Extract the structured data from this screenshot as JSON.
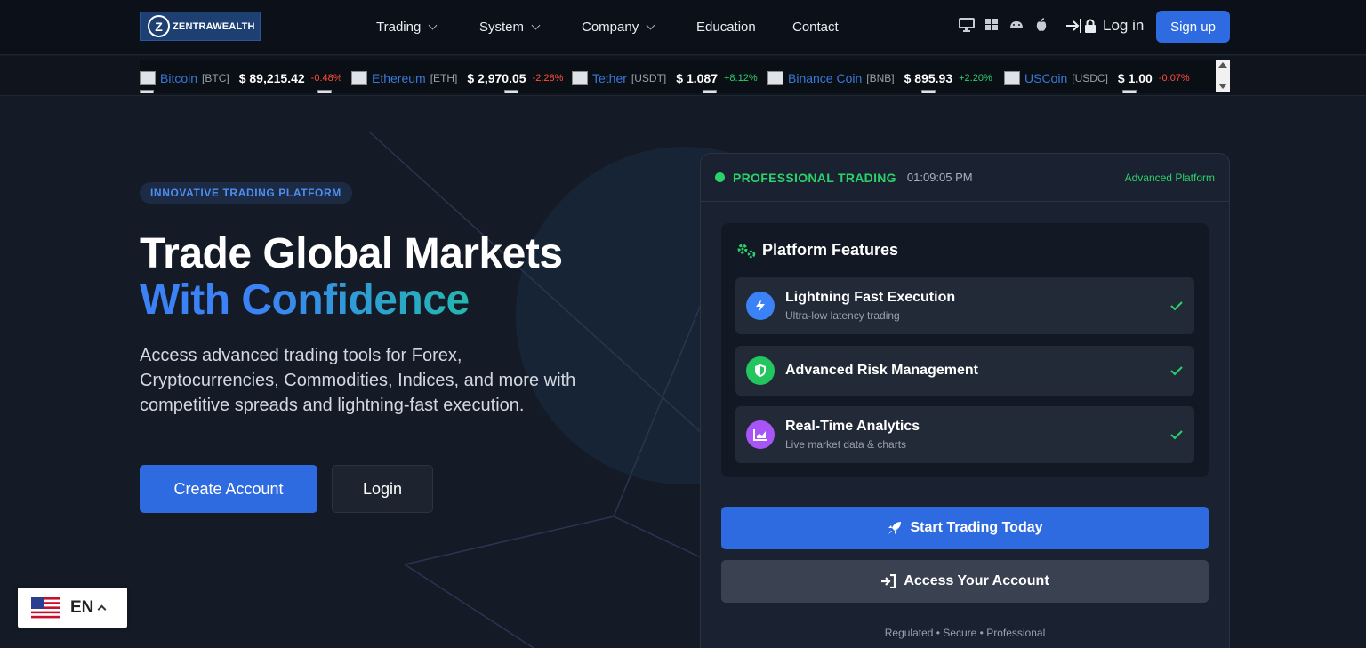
{
  "brand": {
    "logo_text": "ZENTRAWEALTH",
    "logo_mark": "Z"
  },
  "nav": {
    "items": [
      {
        "label": "Trading",
        "dropdown": true
      },
      {
        "label": "System",
        "dropdown": true
      },
      {
        "label": "Company",
        "dropdown": true
      },
      {
        "label": "Education",
        "dropdown": false
      },
      {
        "label": "Contact",
        "dropdown": false
      }
    ],
    "platform_icons": [
      "desktop-icon",
      "windows-icon",
      "android-icon",
      "apple-icon"
    ],
    "login_label": "Log in",
    "signup_label": "Sign up"
  },
  "ticker": [
    {
      "name": "Bitcoin",
      "symbol": "[BTC]",
      "price": "$ 89,215.42",
      "change": "-0.48%",
      "direction": "down"
    },
    {
      "name": "Ethereum",
      "symbol": "[ETH]",
      "price": "$ 2,970.05",
      "change": "-2.28%",
      "direction": "down"
    },
    {
      "name": "Tether",
      "symbol": "[USDT]",
      "price": "$ 1.087",
      "change": "+8.12%",
      "direction": "up"
    },
    {
      "name": "Binance Coin",
      "symbol": "[BNB]",
      "price": "$ 895.93",
      "change": "+2.20%",
      "direction": "up"
    },
    {
      "name": "USCoin",
      "symbol": "[USDC]",
      "price": "$ 1.00",
      "change": "-0.07%",
      "direction": "down"
    }
  ],
  "hero": {
    "badge": "INNOVATIVE TRADING PLATFORM",
    "title_line1": "Trade Global Markets",
    "title_line2": "With Confidence",
    "description": "Access advanced trading tools for Forex, Cryptocurrencies, Commodities, Indices, and more with competitive spreads and lightning-fast execution.",
    "primary_cta": "Create Account",
    "secondary_cta": "Login"
  },
  "card": {
    "status_label": "PROFESSIONAL TRADING",
    "time": "01:09:05 PM",
    "tag": "Advanced Platform",
    "features_title": "Platform Features",
    "features": [
      {
        "name": "Lightning Fast Execution",
        "sub": "Ultra-low latency trading",
        "icon": "bolt-icon",
        "color": "#3b82f6"
      },
      {
        "name": "Advanced Risk Management",
        "sub": "",
        "icon": "shield-icon",
        "color": "#22c55e"
      },
      {
        "name": "Real-Time Analytics",
        "sub": "Live market data & charts",
        "icon": "chart-icon",
        "color": "#a855f7"
      }
    ],
    "start_label": "Start Trading Today",
    "access_label": "Access Your Account",
    "footer": "Regulated • Secure • Professional"
  },
  "language": {
    "code": "EN"
  },
  "colors": {
    "accent": "#2f6be0",
    "success": "#2bd16a",
    "danger": "#ff4d3a",
    "background": "#141a26"
  }
}
